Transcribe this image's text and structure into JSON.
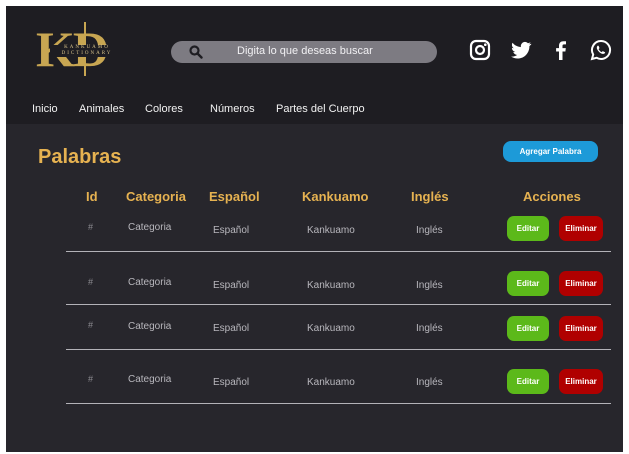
{
  "logo": {
    "letters": "KD",
    "subtitle": "KANKUAMO DICTIONARY"
  },
  "search": {
    "placeholder": "Digita lo que deseas buscar",
    "icon": "search-icon"
  },
  "social": [
    {
      "name": "instagram-icon"
    },
    {
      "name": "twitter-icon"
    },
    {
      "name": "facebook-icon"
    },
    {
      "name": "whatsapp-icon"
    }
  ],
  "nav": {
    "items": [
      "Inicio",
      "Animales",
      "Colores",
      "Números",
      "Partes del Cuerpo"
    ]
  },
  "page": {
    "title": "Palabras",
    "add_button": "Agregar Palabra"
  },
  "table": {
    "headers": [
      "Id",
      "Categoria",
      "Español",
      "Kankuamo",
      "Inglés",
      "Acciones"
    ],
    "rows": [
      {
        "id": "#",
        "categoria": "Categoria",
        "espanol": "Español",
        "kankuamo": "Kankuamo",
        "ingles": "Inglés",
        "edit": "Editar",
        "delete": "Eliminar"
      },
      {
        "id": "#",
        "categoria": "Categoria",
        "espanol": "Español",
        "kankuamo": "Kankuamo",
        "ingles": "Inglés",
        "edit": "Editar",
        "delete": "Eliminar"
      },
      {
        "id": "#",
        "categoria": "Categoria",
        "espanol": "Español",
        "kankuamo": "Kankuamo",
        "ingles": "Inglés",
        "edit": "Editar",
        "delete": "Eliminar"
      },
      {
        "id": "#",
        "categoria": "Categoria",
        "espanol": "Español",
        "kankuamo": "Kankuamo",
        "ingles": "Inglés",
        "edit": "Editar",
        "delete": "Eliminar"
      }
    ]
  },
  "colors": {
    "accent": "#e6b251",
    "header_bg": "#1e1d22",
    "page_bg": "#27262c",
    "primary_button": "#1d9ad8",
    "edit_button": "#5cb91a",
    "delete_button": "#b00000"
  }
}
